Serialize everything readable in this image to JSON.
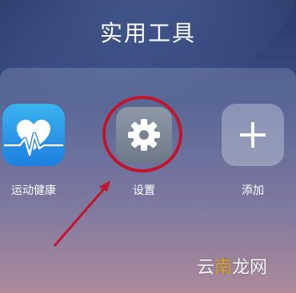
{
  "folder": {
    "title": "实用工具"
  },
  "apps": [
    {
      "label": "运动健康",
      "icon": "health-heart-icon"
    },
    {
      "label": "设置",
      "icon": "gear-icon"
    },
    {
      "label": "添加",
      "icon": "plus-icon"
    }
  ],
  "annotation": {
    "highlight_color": "#c0152a"
  },
  "watermark": {
    "prefix": "云",
    "accent": "南",
    "suffix": "龙网"
  }
}
